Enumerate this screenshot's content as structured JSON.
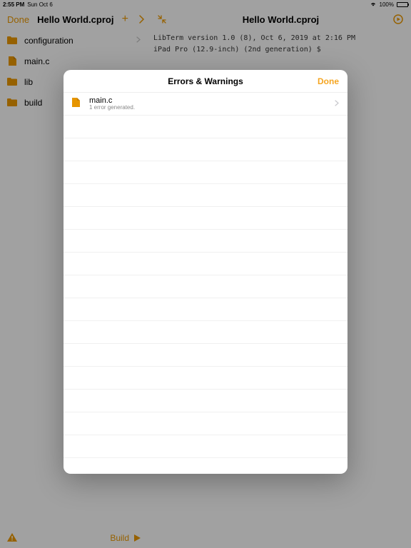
{
  "statusbar": {
    "time": "2:55 PM",
    "date": "Sun Oct 6",
    "wifi_pct": "100%"
  },
  "toolbar": {
    "done_label": "Done",
    "project_title_left": "Hello World.cproj",
    "project_title_right": "Hello World.cproj"
  },
  "sidebar": {
    "items": [
      {
        "type": "folder",
        "label": "configuration",
        "has_children": true
      },
      {
        "type": "file",
        "label": "main.c",
        "has_children": false
      },
      {
        "type": "folder",
        "label": "lib",
        "has_children": true
      },
      {
        "type": "folder",
        "label": "build",
        "has_children": true
      }
    ]
  },
  "terminal": {
    "line1": "LibTerm version 1.0 (8), Oct 6, 2019 at 2:16 PM",
    "line2": "iPad Pro (12.9-inch) (2nd generation) $"
  },
  "bottombar": {
    "build_label": "Build"
  },
  "modal": {
    "title": "Errors & Warnings",
    "done_label": "Done",
    "rows": [
      {
        "filename": "main.c",
        "subtitle": "1 error generated."
      }
    ],
    "empty_row_count": 16
  },
  "colors": {
    "accent": "#e69500"
  }
}
